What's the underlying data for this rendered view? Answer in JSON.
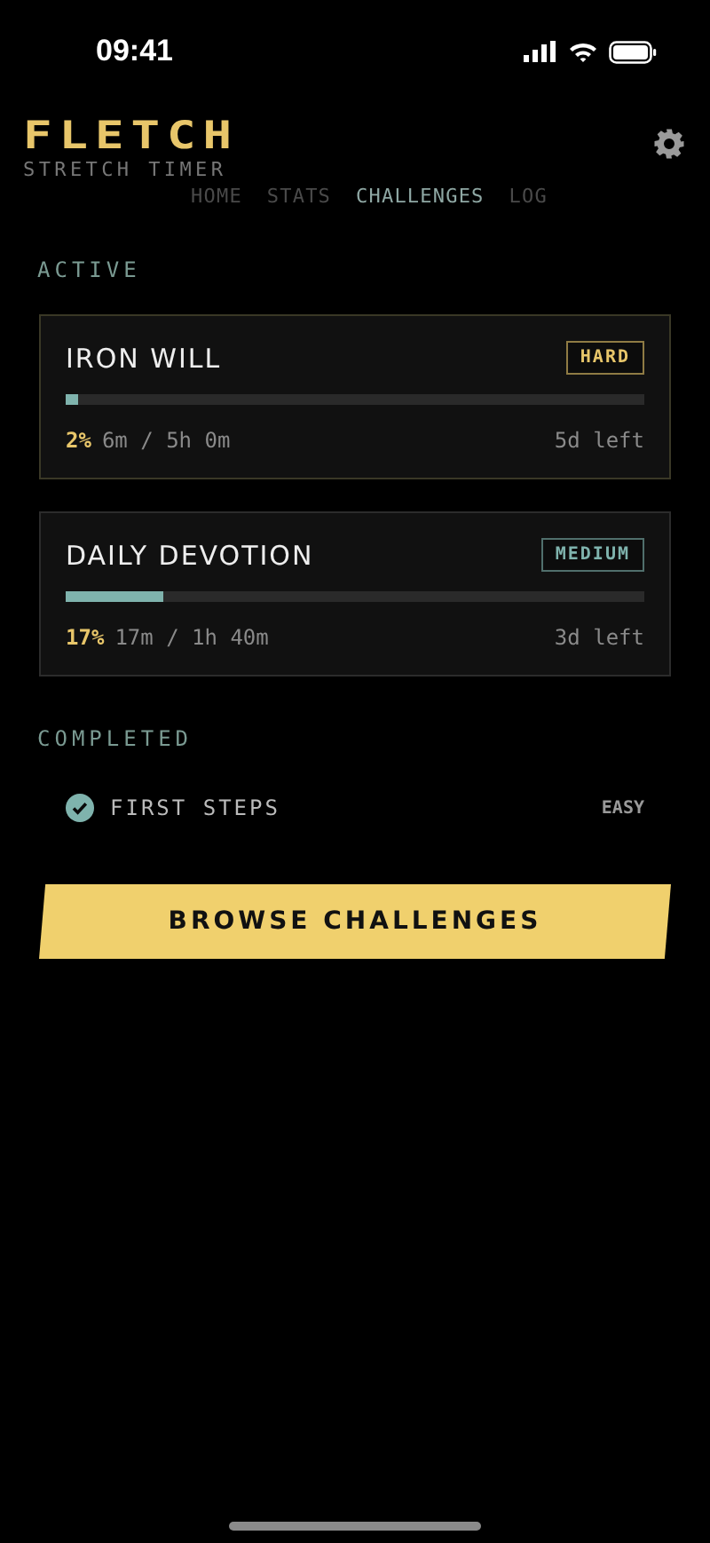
{
  "status_bar": {
    "time": "09:41"
  },
  "header": {
    "title": "FLETCH",
    "subtitle": "STRETCH TIMER"
  },
  "nav": [
    {
      "label": "HOME",
      "selected": false
    },
    {
      "label": "STATS",
      "selected": false
    },
    {
      "label": "CHALLENGES",
      "selected": true
    },
    {
      "label": "LOG",
      "selected": false
    }
  ],
  "active": {
    "heading": "ACTIVE",
    "challenges": [
      {
        "name": "IRON WILL",
        "difficulty": "HARD",
        "color": "#e8c66a",
        "level": 0.02,
        "percent": "2%",
        "progress": "6m / 5h 0m",
        "remaining": "5d left"
      },
      {
        "name": "DAILY DEVOTION",
        "difficulty": "MEDIUM",
        "color": "#7fb3ad",
        "level": 0.17,
        "percent": "17%",
        "progress": "17m / 1h 40m",
        "remaining": "3d left"
      }
    ]
  },
  "completed": {
    "heading": "COMPLETED",
    "challenges": [
      {
        "name": "FIRST STEPS",
        "difficulty": "EASY",
        "checked": true
      }
    ]
  },
  "browse_button": "BROWSE CHALLENGES"
}
